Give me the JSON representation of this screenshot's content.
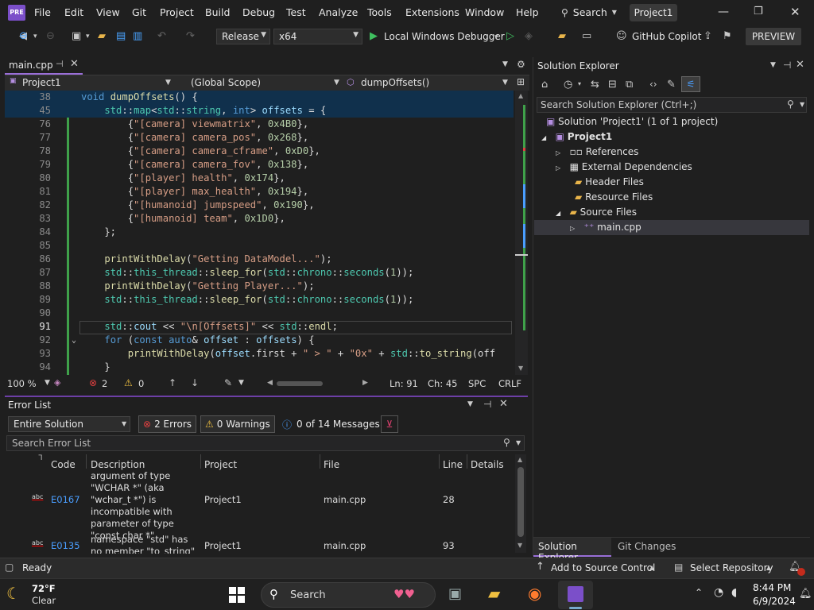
{
  "menu": {
    "items": [
      "File",
      "Edit",
      "View",
      "Git",
      "Project",
      "Build",
      "Debug",
      "Test",
      "Analyze",
      "Tools",
      "Extensions",
      "Window",
      "Help"
    ],
    "search_label": "Search",
    "project_badge": "Project1"
  },
  "toolbar": {
    "config": "Release",
    "platform": "x64",
    "debugger": "Local Windows Debugger",
    "copilot": "GitHub Copilot",
    "preview": "PREVIEW"
  },
  "editor": {
    "tab_name": "main.cpp",
    "nav_project": "Project1",
    "nav_scope": "(Global Scope)",
    "nav_member": "dumpOffsets()",
    "lines": [
      {
        "n": "38",
        "html": "<span class=\"kw\">void</span> <span class=\"fn\">dumpOffsets</span>() {"
      },
      {
        "n": "45",
        "html": "    <span class=\"ns\">std</span>::<span class=\"ty\">map</span>&lt;<span class=\"ns\">std</span>::<span class=\"ty\">string</span>, <span class=\"kw\">int</span>&gt; <span class=\"vr\">offsets</span> = {"
      },
      {
        "n": "76",
        "html": "        {<span class=\"st\">\"[camera] viewmatrix\"</span>, <span class=\"nm\">0x4B0</span>},"
      },
      {
        "n": "77",
        "html": "        {<span class=\"st\">\"[camera] camera_pos\"</span>, <span class=\"nm\">0x268</span>},"
      },
      {
        "n": "78",
        "html": "        {<span class=\"st\">\"[camera] camera_cframe\"</span>, <span class=\"nm\">0xD0</span>},"
      },
      {
        "n": "79",
        "html": "        {<span class=\"st\">\"[camera] camera_fov\"</span>, <span class=\"nm\">0x138</span>},"
      },
      {
        "n": "80",
        "html": "        {<span class=\"st\">\"[player] health\"</span>, <span class=\"nm\">0x174</span>},"
      },
      {
        "n": "81",
        "html": "        {<span class=\"st\">\"[player] max_health\"</span>, <span class=\"nm\">0x194</span>},"
      },
      {
        "n": "82",
        "html": "        {<span class=\"st\">\"[humanoid] jumpspeed\"</span>, <span class=\"nm\">0x190</span>},"
      },
      {
        "n": "83",
        "html": "        {<span class=\"st\">\"[humanoid] team\"</span>, <span class=\"nm\">0x1D0</span>},"
      },
      {
        "n": "84",
        "html": "    };"
      },
      {
        "n": "85",
        "html": ""
      },
      {
        "n": "86",
        "html": "    <span class=\"fn\">printWithDelay</span>(<span class=\"st\">\"Getting DataModel...\"</span>);"
      },
      {
        "n": "87",
        "html": "    <span class=\"ns\">std</span>::<span class=\"ns\">this_thread</span>::<span class=\"fn\">sleep_for</span>(<span class=\"ns\">std</span>::<span class=\"ns\">chrono</span>::<span class=\"ty\">seconds</span>(<span class=\"nm\">1</span>));"
      },
      {
        "n": "88",
        "html": "    <span class=\"fn\">printWithDelay</span>(<span class=\"st\">\"Getting Player...\"</span>);"
      },
      {
        "n": "89",
        "html": "    <span class=\"ns\">std</span>::<span class=\"ns\">this_thread</span>::<span class=\"fn\">sleep_for</span>(<span class=\"ns\">std</span>::<span class=\"ns\">chrono</span>::<span class=\"ty\">seconds</span>(<span class=\"nm\">1</span>));"
      },
      {
        "n": "90",
        "html": ""
      },
      {
        "n": "91",
        "html": "    <span class=\"ns\">std</span>::<span class=\"vr\">cout</span> &lt;&lt; <span class=\"st\">\"\\n[Offsets]\"</span> &lt;&lt; <span class=\"ns\">std</span>::<span class=\"fn\">endl</span>;"
      },
      {
        "n": "92",
        "html": "    <span class=\"kw\">for</span> (<span class=\"kw\">const auto</span>&amp; <span class=\"vr\">offset</span> : <span class=\"vr\">offsets</span>) {"
      },
      {
        "n": "93",
        "html": "        <span class=\"fn\">printWithDelay</span>(<span class=\"vr\">offset</span>.first + <span class=\"st\">\" > \"</span> + <span class=\"st\">\"0x\"</span> + <span class=\"ns\">std</span>::<span class=\"fn\">to_string</span>(off"
      },
      {
        "n": "94",
        "html": "    }"
      }
    ]
  },
  "editor_status": {
    "zoom": "100 %",
    "errors": "2",
    "warnings": "0",
    "line": "Ln: 91",
    "col": "Ch: 45",
    "spc": "SPC",
    "eol": "CRLF"
  },
  "error_list": {
    "title": "Error List",
    "scope": "Entire Solution",
    "errors_btn": "2 Errors",
    "warnings_btn": "0 Warnings",
    "messages_btn": "0 of 14 Messages",
    "search_placeholder": "Search Error List",
    "columns": [
      "Code",
      "Description",
      "Project",
      "File",
      "Line",
      "Details"
    ],
    "rows": [
      {
        "code": "E0167",
        "description": "argument of type \"WCHAR *\" (aka \"wchar_t *\") is incompatible with parameter of type \"const char *\"",
        "project": "Project1",
        "file": "main.cpp",
        "line": "28"
      },
      {
        "code": "E0135",
        "description": "namespace \"std\" has no member \"to_string\"",
        "project": "Project1",
        "file": "main.cpp",
        "line": "93"
      }
    ]
  },
  "solution_explorer": {
    "title": "Solution Explorer",
    "search_placeholder": "Search Solution Explorer (Ctrl+;)",
    "solution": "Solution 'Project1' (1 of 1 project)",
    "project": "Project1",
    "items": [
      "References",
      "External Dependencies",
      "Header Files",
      "Resource Files",
      "Source Files",
      "main.cpp"
    ],
    "bottom_tabs": [
      "Solution Explorer",
      "Git Changes"
    ]
  },
  "statusbar": {
    "ready": "Ready",
    "source_control": "Add to Source Control",
    "repository": "Select Repository"
  },
  "taskbar": {
    "temp": "72°F",
    "weather": "Clear",
    "search": "Search",
    "time": "8:44 PM",
    "date": "6/9/2024"
  }
}
